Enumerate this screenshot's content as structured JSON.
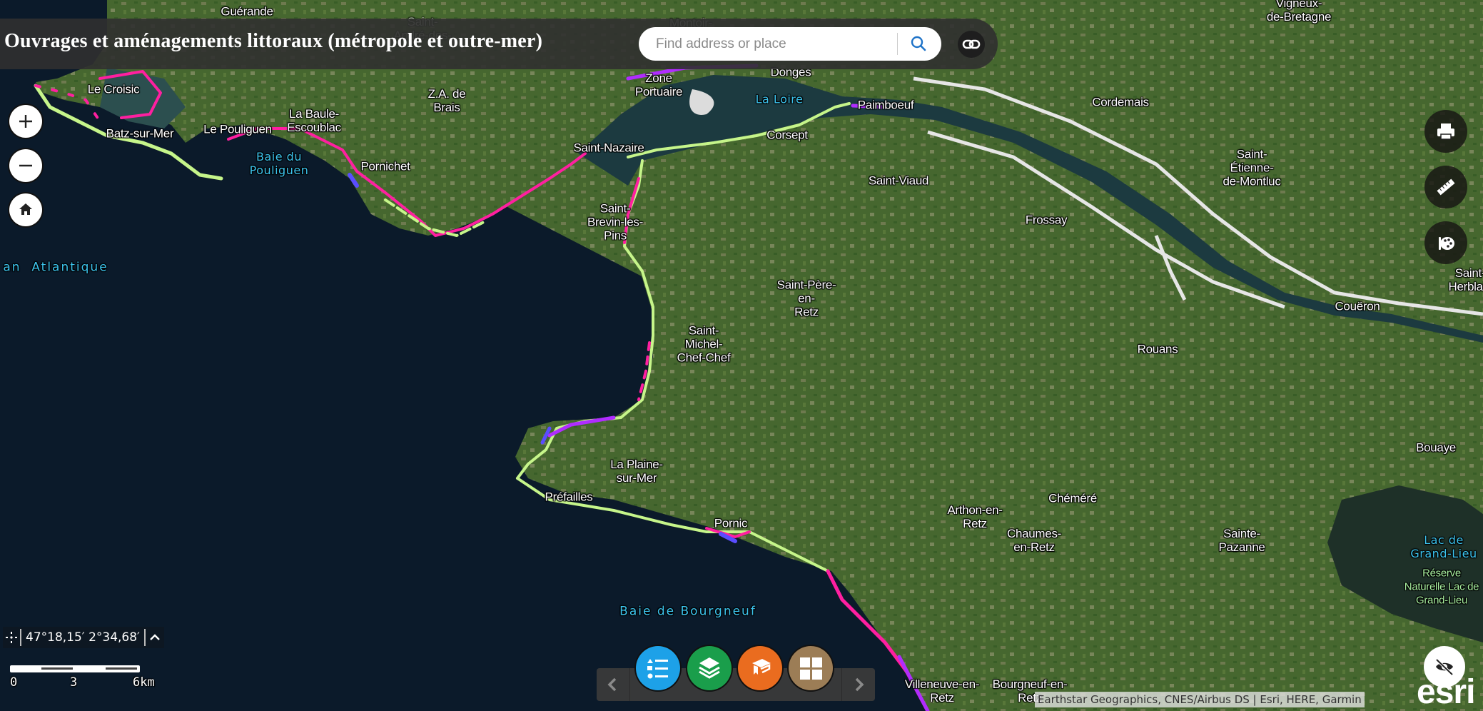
{
  "app": {
    "title": "Ouvrages et aménagements littoraux (métropole et outre-mer)"
  },
  "search": {
    "placeholder": "Find address or place",
    "value": ""
  },
  "icons": {
    "search": "search-icon",
    "share_link": "link-icon",
    "zoom_in": "plus-icon",
    "zoom_out": "minus-icon",
    "home": "home-icon",
    "print": "printer-icon",
    "measure": "ruler-icon",
    "basemap": "palette-icon",
    "coord_mode": "crosshair-icon",
    "coord_expand": "chevron-up-icon",
    "dock_prev": "chevron-left-icon",
    "dock_next": "chevron-right-icon",
    "legend": "legend-list-icon",
    "layers": "layers-icon",
    "about": "graduation-cap-icon",
    "gallery": "grid-icon",
    "visibility": "eye-off-icon"
  },
  "coordinates": {
    "text": "47°18,15′ 2°34,68′"
  },
  "scalebar": {
    "labels": [
      "0",
      "3",
      "6km"
    ]
  },
  "dock": {
    "buttons": [
      {
        "name": "legend",
        "color": "#1da1e8"
      },
      {
        "name": "layers",
        "color": "#1a9e4b"
      },
      {
        "name": "about",
        "color": "#ea6c1f"
      },
      {
        "name": "gallery",
        "color": "#9c7d56"
      }
    ]
  },
  "attribution": "Earthstar Geographics, CNES/Airbus DS | Esri, HERE, Garmin",
  "esri_logo": "esri",
  "colors": {
    "header_bg": "#303030",
    "water": "#0b1a2a",
    "land": "#4a6a35",
    "coast_lime": "#c6f58a",
    "coast_magenta": "#ff1fa0",
    "coast_purple": "#b02cff",
    "coast_blue": "#5a4dff",
    "water_label": "#3cc4ee"
  },
  "map": {
    "places": [
      {
        "name": "Guérande"
      },
      {
        "name": "Saint-\nAndré-des-"
      },
      {
        "name": "Montoir-"
      },
      {
        "name": "Le Croisic"
      },
      {
        "name": "Batz-sur-Mer"
      },
      {
        "name": "Le Pouliguen"
      },
      {
        "name": "La Baule-\nEscoublac"
      },
      {
        "name": "Z.A. de\nBrais"
      },
      {
        "name": "Zone\nPortuaire"
      },
      {
        "name": "Donges"
      },
      {
        "name": "Paimboeuf"
      },
      {
        "name": "Corsept"
      },
      {
        "name": "Cordemais"
      },
      {
        "name": "Vigneux-\nde-Bretagne"
      },
      {
        "name": "Pornichet"
      },
      {
        "name": "Saint-Nazaire"
      },
      {
        "name": "Saint-Viaud"
      },
      {
        "name": "Saint-\nÉtienne-\nde-Montluc"
      },
      {
        "name": "Saint-\nBrevin-les-\nPins"
      },
      {
        "name": "Frossay"
      },
      {
        "name": "Saint-Père-\nen-\nRetz"
      },
      {
        "name": "Couëron"
      },
      {
        "name": "Saint-\nHerblain"
      },
      {
        "name": "Saint-\nMichel-\nChef-Chef"
      },
      {
        "name": "Rouans"
      },
      {
        "name": "Bouaye"
      },
      {
        "name": "La Plaine-\nsur-Mer"
      },
      {
        "name": "Chéméré"
      },
      {
        "name": "Préfailles"
      },
      {
        "name": "Arthon-en-\nRetz"
      },
      {
        "name": "Chaumes-\nen-Retz"
      },
      {
        "name": "Pornic"
      },
      {
        "name": "Sainte-\nPazanne"
      },
      {
        "name": "Villeneuve-en-\nRetz"
      },
      {
        "name": "Bourgneuf-en-\nRetz"
      }
    ],
    "water_labels": [
      {
        "name": "Baie du\nPouliguen"
      },
      {
        "name": "La Loire"
      },
      {
        "name": "an  Atlantique"
      },
      {
        "name": "Baie de Bourgneuf"
      },
      {
        "name": "Lac de\nGrand-Lieu"
      }
    ],
    "reserve_labels": [
      {
        "name": "Réserve\nNaturelle Lac de\nGrand-Lieu"
      }
    ]
  }
}
